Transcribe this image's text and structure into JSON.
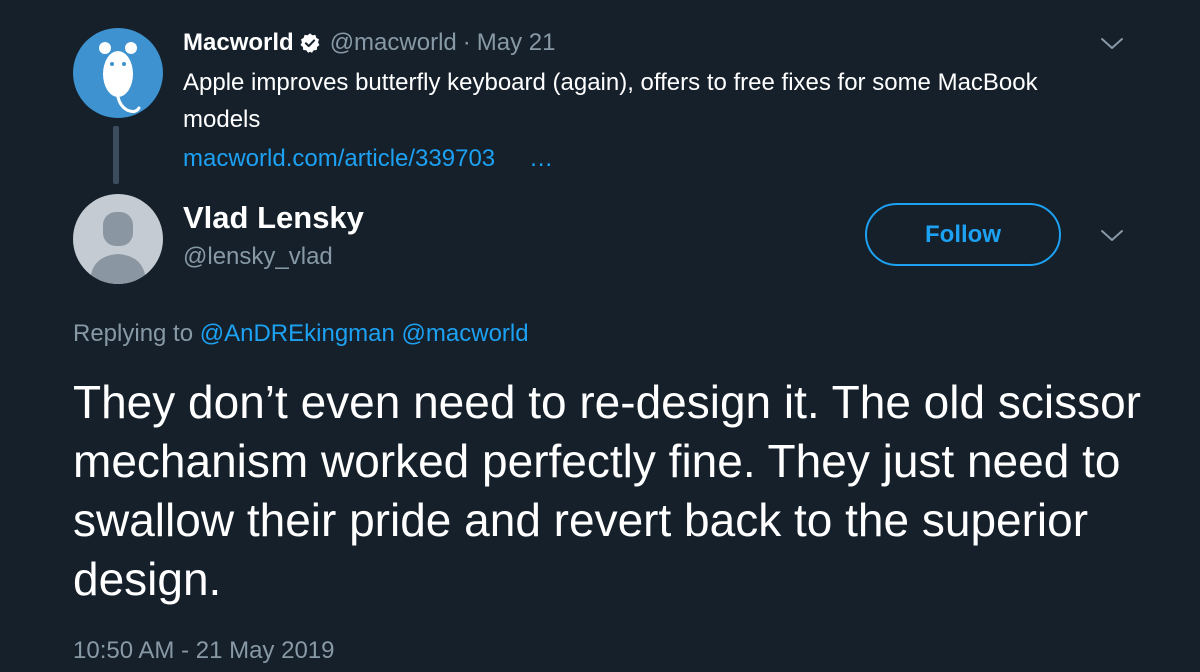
{
  "parent_tweet": {
    "author_name": "Macworld",
    "handle": "@macworld",
    "separator": "·",
    "date": "May 21",
    "text": "Apple improves butterfly keyboard (again), offers to free fixes for some MacBook models",
    "link": "macworld.com/article/339703",
    "ellipsis": "…",
    "avatar_icon": "mouse-icon",
    "verified_icon": "verified-badge-icon",
    "menu_icon": "chevron-down-icon"
  },
  "reply": {
    "author_name": "Vlad Lensky",
    "handle": "@lensky_vlad",
    "follow_label": "Follow",
    "avatar_icon": "default-avatar-icon",
    "menu_icon": "chevron-down-icon",
    "replying_to_label": "Replying to",
    "mentions": [
      "@AnDREkingman",
      "@macworld"
    ],
    "text": "They don’t even need to re-design it. The old scissor mechanism worked perfectly fine. They just need to swallow their pride and revert back to the superior design.",
    "timestamp": "10:50 AM - 21 May 2019"
  },
  "colors": {
    "background": "#15202b",
    "accent": "#1da1f2",
    "secondary_text": "#8899a6",
    "primary_text": "#ffffff",
    "macworld_avatar_bg": "#3d92cf",
    "default_avatar_bg": "#c4cbd2"
  }
}
